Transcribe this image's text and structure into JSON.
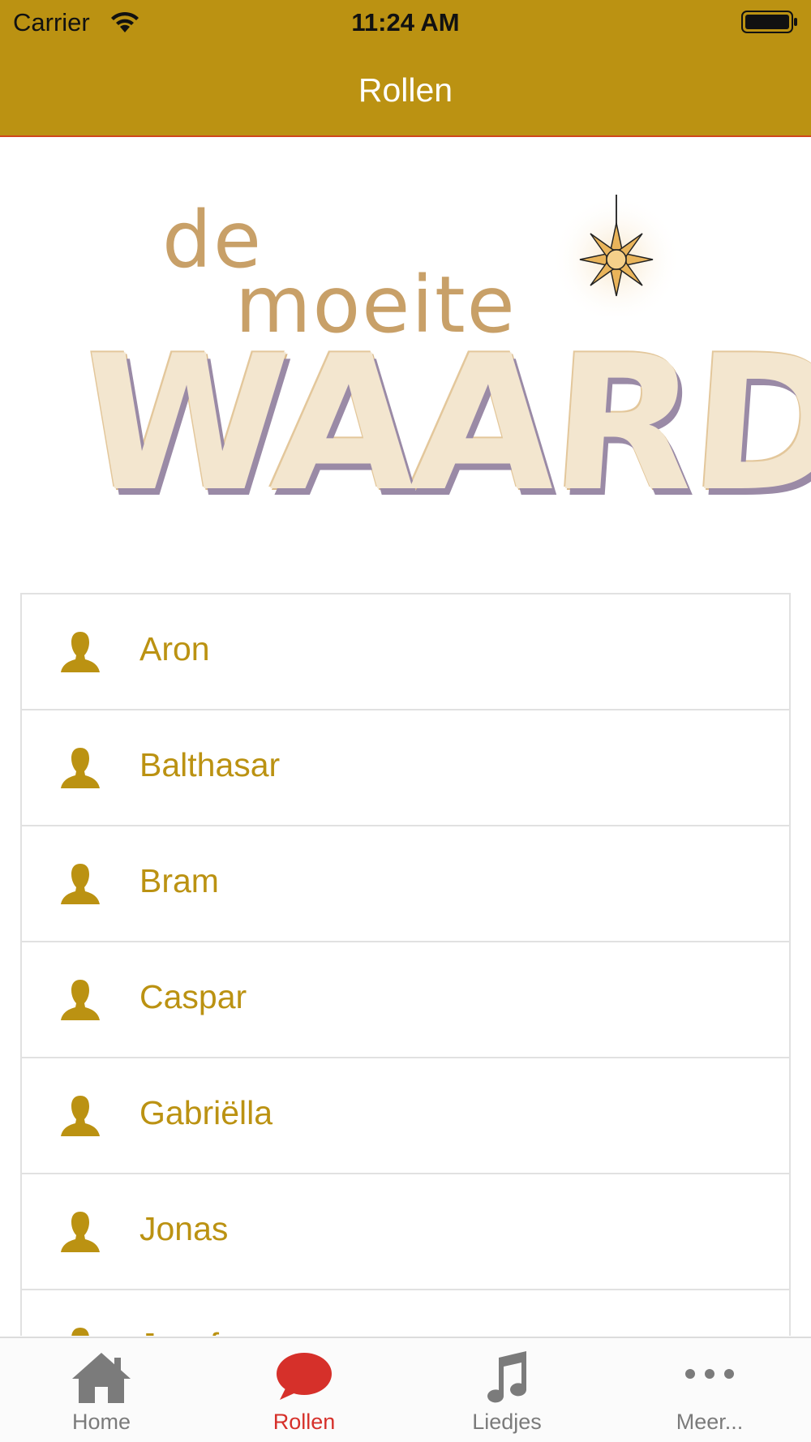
{
  "status_bar": {
    "carrier": "Carrier",
    "time": "11:24 AM",
    "wifi_icon": "wifi-icon",
    "battery_icon": "battery-icon"
  },
  "header": {
    "title": "Rollen",
    "color": "#bb9212"
  },
  "logo": {
    "line1": "de",
    "line2": "moeite",
    "line3": "WAARD!",
    "icon": "star-icon"
  },
  "roles": [
    {
      "name": "Aron",
      "icon": "person-icon"
    },
    {
      "name": "Balthasar",
      "icon": "person-icon"
    },
    {
      "name": "Bram",
      "icon": "person-icon"
    },
    {
      "name": "Caspar",
      "icon": "person-icon"
    },
    {
      "name": "Gabriëlla",
      "icon": "person-icon"
    },
    {
      "name": "Jonas",
      "icon": "person-icon"
    },
    {
      "name": "Jozef",
      "icon": "person-icon"
    }
  ],
  "tab_bar": {
    "tabs": [
      {
        "label": "Home",
        "icon": "home-icon",
        "active": false
      },
      {
        "label": "Rollen",
        "icon": "speech-bubble-icon",
        "active": true
      },
      {
        "label": "Liedjes",
        "icon": "music-note-icon",
        "active": false
      },
      {
        "label": "Meer...",
        "icon": "more-icon",
        "active": false
      }
    ],
    "active_color": "#d6302a",
    "inactive_color": "#7b7b7b"
  }
}
